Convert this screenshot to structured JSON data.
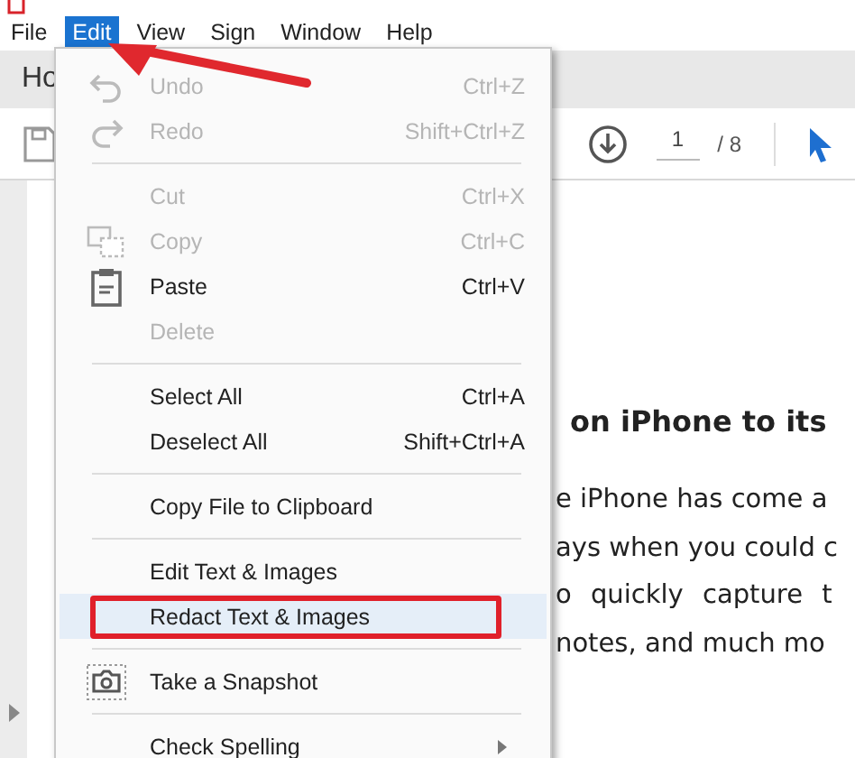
{
  "menubar": [
    {
      "label": "File",
      "selected": false
    },
    {
      "label": "Edit",
      "selected": true
    },
    {
      "label": "View",
      "selected": false
    },
    {
      "label": "Sign",
      "selected": false
    },
    {
      "label": "Window",
      "selected": false
    },
    {
      "label": "Help",
      "selected": false
    }
  ],
  "tabs": [
    {
      "label": "Ho"
    }
  ],
  "toolbar": {
    "page_value": "1",
    "page_total": "/ 8"
  },
  "document": {
    "heading": "on iPhone to its",
    "lines": [
      "e iPhone has come a",
      "ays when you could c",
      "o quickly capture t",
      "notes, and much mo"
    ]
  },
  "menu": [
    {
      "kind": "command",
      "label": "Undo",
      "shortcut": "Ctrl+Z",
      "disabled": true,
      "highlighted": false,
      "boxed": false
    },
    {
      "kind": "command",
      "label": "Redo",
      "shortcut": "Shift+Ctrl+Z",
      "disabled": true,
      "highlighted": false,
      "boxed": false
    },
    {
      "kind": "separator"
    },
    {
      "kind": "command",
      "label": "Cut",
      "shortcut": "Ctrl+X",
      "disabled": true,
      "highlighted": false,
      "boxed": false
    },
    {
      "kind": "command",
      "label": "Copy",
      "shortcut": "Ctrl+C",
      "disabled": true,
      "highlighted": false,
      "boxed": false
    },
    {
      "kind": "command",
      "label": "Paste",
      "shortcut": "Ctrl+V",
      "disabled": false,
      "highlighted": false,
      "boxed": false
    },
    {
      "kind": "command",
      "label": "Delete",
      "disabled": true,
      "highlighted": false,
      "boxed": false
    },
    {
      "kind": "separator"
    },
    {
      "kind": "command",
      "label": "Select All",
      "shortcut": "Ctrl+A",
      "disabled": false,
      "highlighted": false,
      "boxed": false
    },
    {
      "kind": "command",
      "label": "Deselect All",
      "shortcut": "Shift+Ctrl+A",
      "disabled": false,
      "highlighted": false,
      "boxed": false
    },
    {
      "kind": "separator"
    },
    {
      "kind": "command",
      "label": "Copy File to Clipboard",
      "disabled": false,
      "highlighted": false,
      "boxed": false
    },
    {
      "kind": "separator"
    },
    {
      "kind": "command",
      "label": "Edit Text & Images",
      "disabled": false,
      "highlighted": false,
      "boxed": false
    },
    {
      "kind": "command",
      "label": "Redact Text & Images",
      "disabled": false,
      "highlighted": true,
      "boxed": true
    },
    {
      "kind": "separator"
    },
    {
      "kind": "command",
      "label": "Take a Snapshot",
      "disabled": false,
      "highlighted": false,
      "boxed": false
    },
    {
      "kind": "separator"
    },
    {
      "kind": "submenu",
      "label": "Check Spelling",
      "disabled": false,
      "highlighted": false,
      "boxed": false
    }
  ]
}
